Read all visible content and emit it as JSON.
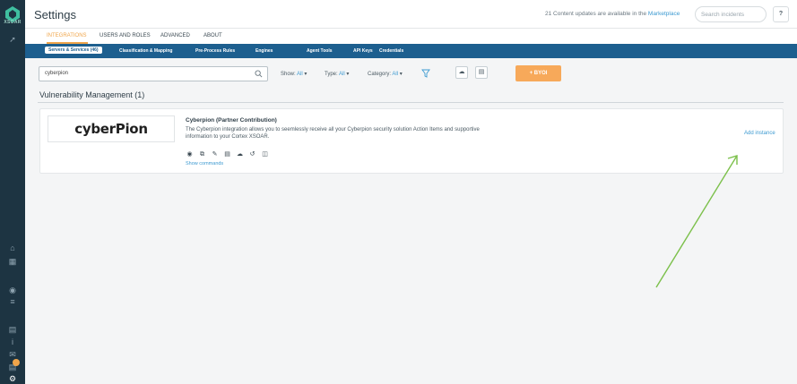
{
  "rail": {
    "logo_text": "XSOAR",
    "icons": [
      "pin-icon",
      "home-icon",
      "calendar-icon",
      "radar-icon",
      "layers-icon",
      "book-icon",
      "info-icon",
      "mail-icon",
      "notes-icon",
      "gear-icon"
    ]
  },
  "header": {
    "title": "Settings",
    "updates_prefix": "21 Content updates are available in the",
    "updates_link": "Marketplace",
    "search_placeholder": "Search incidents",
    "help_label": "?"
  },
  "main_tabs": [
    {
      "label": "INTEGRATIONS",
      "active": true
    },
    {
      "label": "USERS AND ROLES",
      "active": false
    },
    {
      "label": "ADVANCED",
      "active": false
    },
    {
      "label": "ABOUT",
      "active": false
    }
  ],
  "sub_tabs": [
    {
      "label": "Servers & Services (46)",
      "active": true
    },
    {
      "label": "Classification & Mapping",
      "active": false
    },
    {
      "label": "Pre-Process Rules",
      "active": false
    },
    {
      "label": "Engines",
      "active": false
    },
    {
      "label": "Agent Tools",
      "active": false
    },
    {
      "label": "API Keys",
      "active": false
    },
    {
      "label": "Credentials",
      "active": false
    }
  ],
  "toolbar": {
    "search_value": "cyberpion",
    "show_label": "Show:",
    "show_value": "All",
    "type_label": "Type:",
    "type_value": "All",
    "category_label": "Category:",
    "category_value": "All",
    "byoi_label": "+ BYOI"
  },
  "section": {
    "title": "Vulnerability Management (1)"
  },
  "integration": {
    "logo_text": "cyberPion",
    "name": "Cyberpion (Partner Contribution)",
    "description": "The Cyberpion integration allows you to seemlessly receive all your Cyberpion security solution Action Items and supportive information to your Cortex XSOAR.",
    "show_commands": "Show commands",
    "add_instance": "Add instance",
    "action_icons": [
      "eye-icon",
      "copy-icon",
      "edit-icon",
      "delete-icon",
      "upload-icon",
      "history-icon",
      "instances-icon"
    ]
  },
  "colors": {
    "rail_bg": "#1d3442",
    "subtabs_bg": "#1d5f8f",
    "accent_orange": "#f0a54a",
    "link_blue": "#3d9ad1",
    "annotation_arrow": "#7cc04b"
  }
}
